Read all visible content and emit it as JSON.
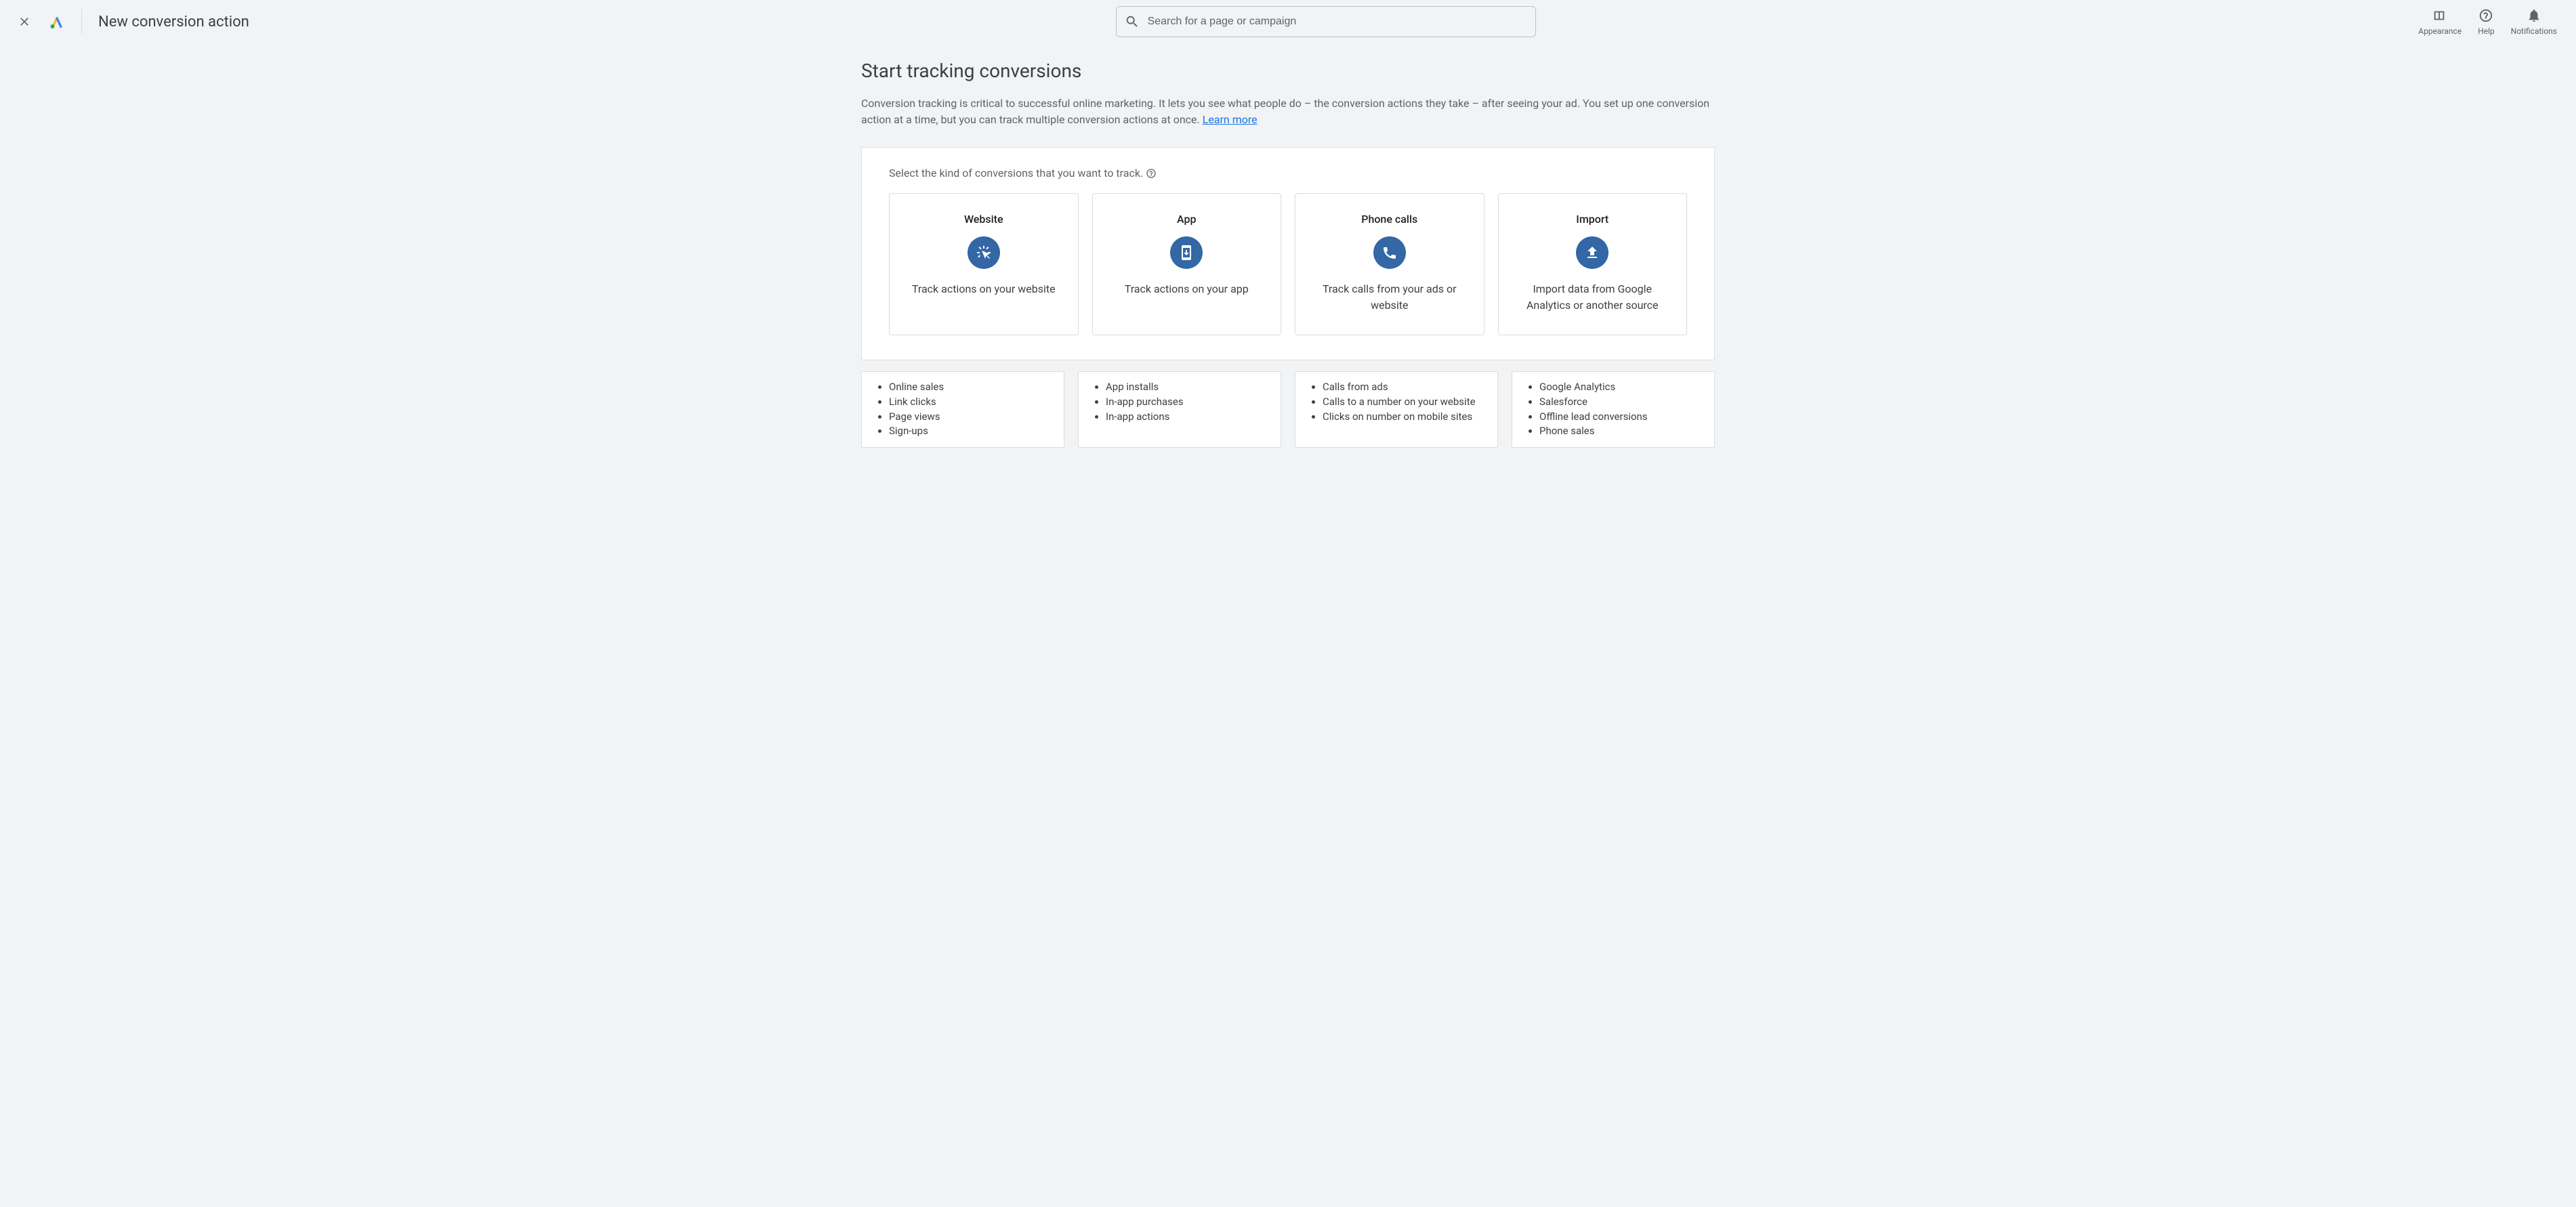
{
  "header": {
    "title": "New conversion action",
    "search_placeholder": "Search for a page or campaign",
    "buttons": {
      "appearance": "Appearance",
      "help": "Help",
      "notifications": "Notifications"
    }
  },
  "page": {
    "heading": "Start tracking conversions",
    "lead_1": "Conversion tracking is critical to successful online marketing. It lets you see what people do – the conversion actions they take – after seeing your ad. You set up one conversion action at a time, but you can track multiple conversion actions at once.  ",
    "learn_more": "Learn more",
    "panel_label": "Select the kind of conversions that you want to track."
  },
  "cards": [
    {
      "title": "Website",
      "desc": "Track actions on your website"
    },
    {
      "title": "App",
      "desc": "Track actions on your app"
    },
    {
      "title": "Phone calls",
      "desc": "Track calls from your ads or website"
    },
    {
      "title": "Import",
      "desc": "Import data from Google Analytics or another source"
    }
  ],
  "examples": [
    [
      "Online sales",
      "Link clicks",
      "Page views",
      "Sign-ups"
    ],
    [
      "App installs",
      "In-app purchases",
      "In-app actions"
    ],
    [
      "Calls from ads",
      "Calls to a number on your website",
      "Clicks on number on mobile sites"
    ],
    [
      "Google Analytics",
      "Salesforce",
      "Offline lead conversions",
      "Phone sales"
    ]
  ]
}
